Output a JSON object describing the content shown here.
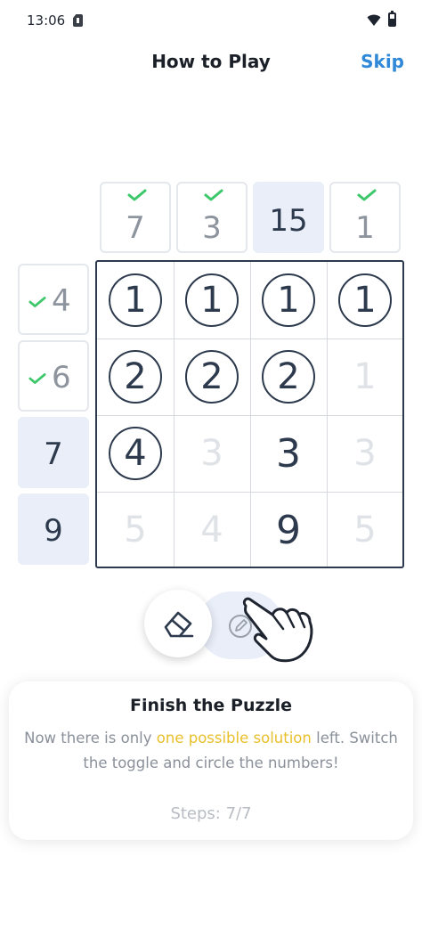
{
  "status": {
    "time": "13:06"
  },
  "header": {
    "title": "How to Play",
    "skip_label": "Skip"
  },
  "puzzle": {
    "column_clues": [
      {
        "value": "7",
        "checked": true
      },
      {
        "value": "3",
        "checked": true
      },
      {
        "value": "15",
        "checked": false
      },
      {
        "value": "1",
        "checked": true
      }
    ],
    "row_clues": [
      {
        "value": "4",
        "checked": true
      },
      {
        "value": "6",
        "checked": true
      },
      {
        "value": "7",
        "checked": false
      },
      {
        "value": "9",
        "checked": false
      }
    ],
    "grid": [
      [
        {
          "v": "1",
          "s": "circled"
        },
        {
          "v": "1",
          "s": "circled"
        },
        {
          "v": "1",
          "s": "circled"
        },
        {
          "v": "1",
          "s": "circled"
        }
      ],
      [
        {
          "v": "2",
          "s": "circled"
        },
        {
          "v": "2",
          "s": "circled"
        },
        {
          "v": "2",
          "s": "circled"
        },
        {
          "v": "1",
          "s": "faded"
        }
      ],
      [
        {
          "v": "4",
          "s": "circled"
        },
        {
          "v": "3",
          "s": "faded"
        },
        {
          "v": "3",
          "s": "plain"
        },
        {
          "v": "3",
          "s": "faded"
        }
      ],
      [
        {
          "v": "5",
          "s": "faded"
        },
        {
          "v": "4",
          "s": "faded"
        },
        {
          "v": "9",
          "s": "plain"
        },
        {
          "v": "5",
          "s": "faded"
        }
      ]
    ]
  },
  "toggle": {
    "icons": [
      "eraser-icon",
      "pencil-circle-icon"
    ],
    "pointer_icon": "hand-pointer-icon"
  },
  "card": {
    "title": "Finish the Puzzle",
    "text_before": "Now there is only ",
    "text_highlight": "one possible solution",
    "text_after": " left. Switch the toggle and circle the numbers!",
    "steps": "Steps: 7/7"
  },
  "colors": {
    "accent": "#2f88d8",
    "check": "#3cc86a",
    "highlight": "#e9bf2a",
    "active_clue_bg": "#e9eef9",
    "ink": "#2d3a4d"
  }
}
